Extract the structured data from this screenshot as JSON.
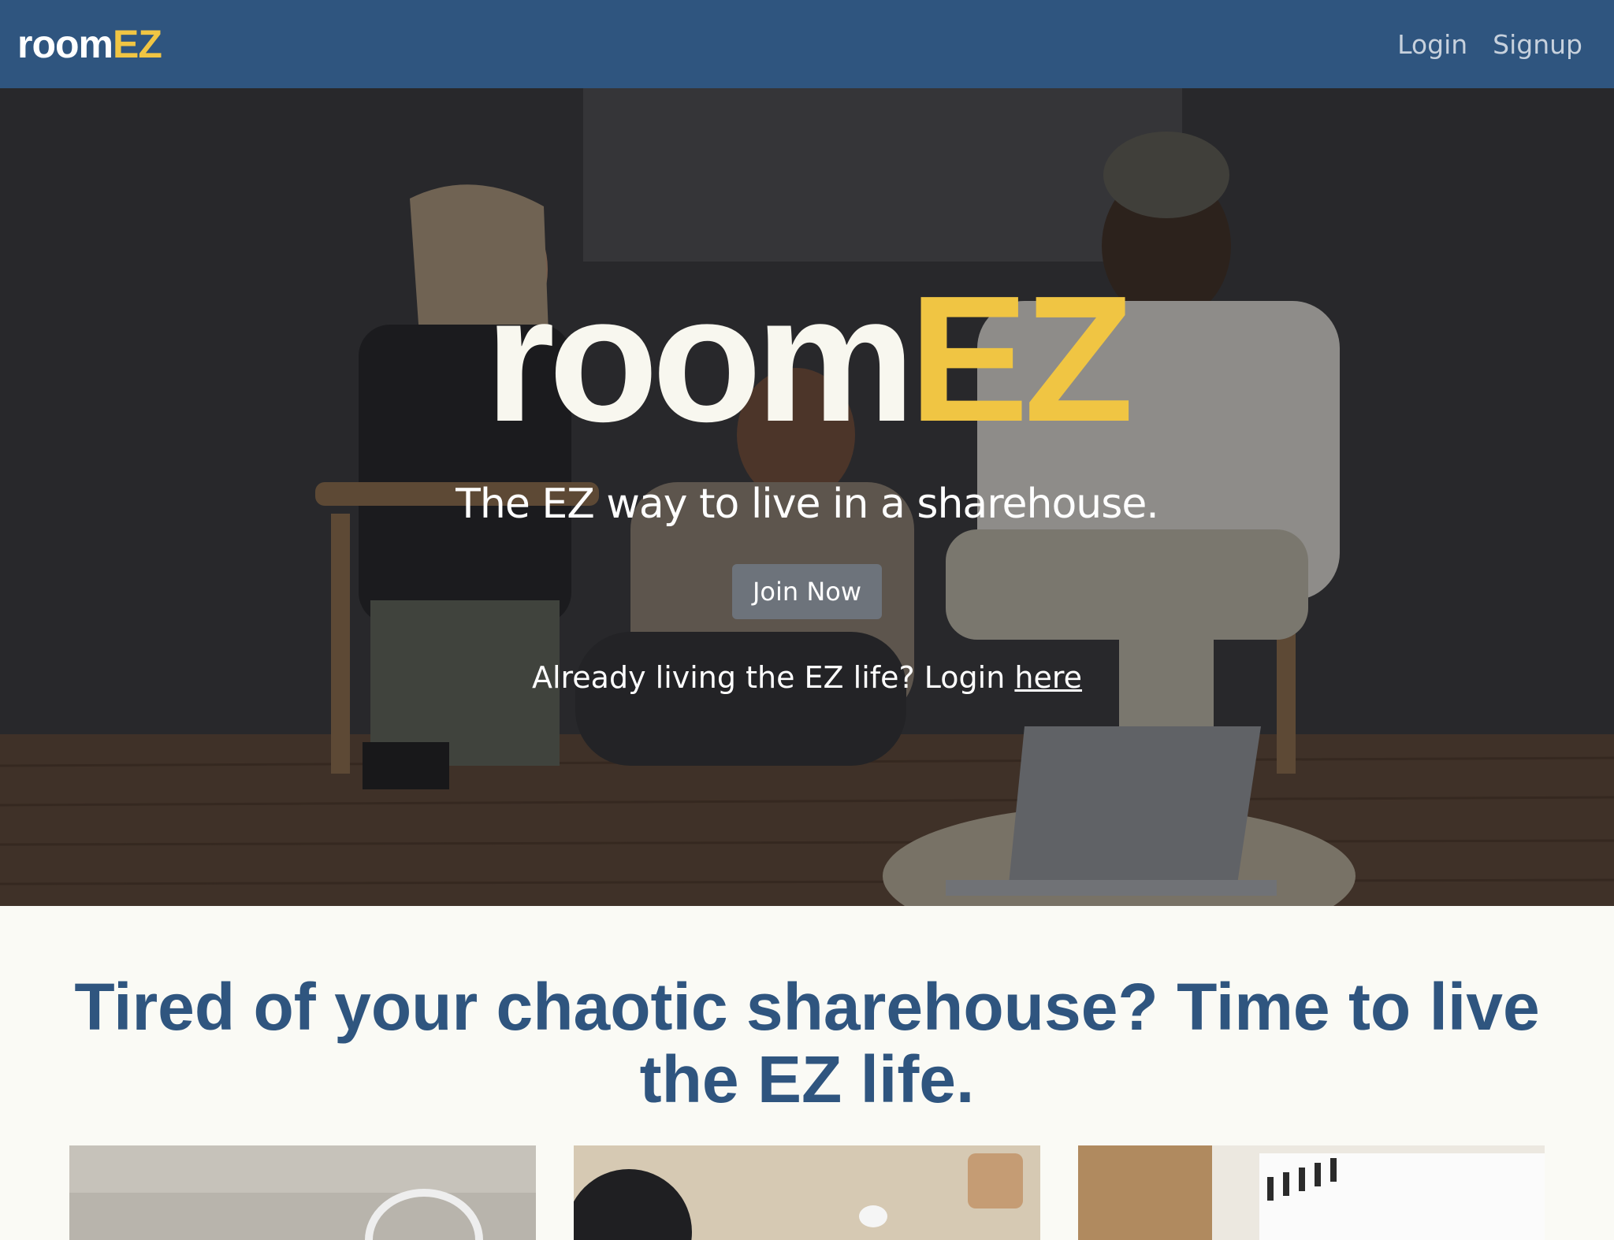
{
  "navbar": {
    "brand_room": "room",
    "brand_ez": "EZ",
    "links": [
      "Login",
      "Signup"
    ]
  },
  "hero": {
    "logo_room": "room",
    "logo_ez": "EZ",
    "tagline": "The EZ way to live in a sharehouse.",
    "cta_label": "Join Now",
    "login_prompt": "Already living the EZ life? Login",
    "login_link": "here"
  },
  "section": {
    "title": "Tired of your chaotic sharehouse? Time to live the EZ life."
  },
  "colors": {
    "primary": "#2f557f",
    "accent": "#f0c543",
    "button": "#6d737b",
    "background": "#fafaf5"
  }
}
